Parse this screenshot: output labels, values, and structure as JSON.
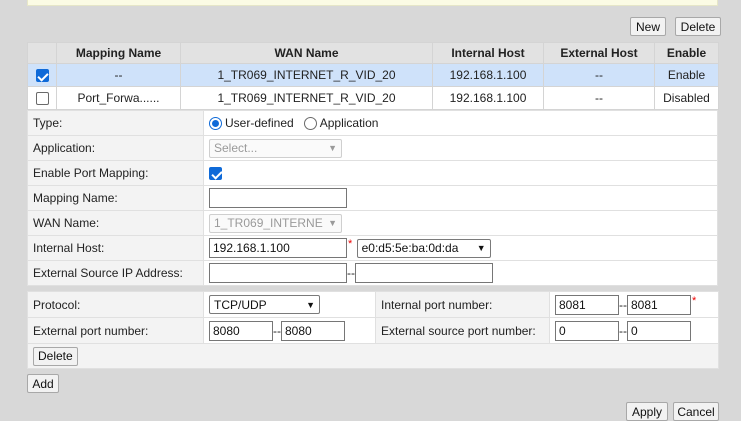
{
  "toolbar": {
    "new_label": "New",
    "delete_label": "Delete"
  },
  "mapping_table": {
    "headers": [
      "Mapping Name",
      "WAN Name",
      "Internal Host",
      "External Host",
      "Enable"
    ],
    "rows": [
      {
        "checked": true,
        "mapping_name": "--",
        "wan_name": "1_TR069_INTERNET_R_VID_20",
        "internal_host": "192.168.1.100",
        "external_host": "--",
        "enable": "Enable"
      },
      {
        "checked": false,
        "mapping_name": "Port_Forwa......",
        "wan_name": "1_TR069_INTERNET_R_VID_20",
        "internal_host": "192.168.1.100",
        "external_host": "--",
        "enable": "Disabled"
      }
    ]
  },
  "form": {
    "type_label": "Type:",
    "type_option_user": "User-defined",
    "type_option_app": "Application",
    "type_selected": "User-defined",
    "application_label": "Application:",
    "application_value": "Select...",
    "enable_label": "Enable Port Mapping:",
    "enable_checked": true,
    "mapping_name_label": "Mapping Name:",
    "mapping_name_value": "",
    "wan_name_label": "WAN Name:",
    "wan_name_value": "1_TR069_INTERNE",
    "internal_host_label": "Internal Host:",
    "internal_host_value": "192.168.1.100",
    "internal_host_mac": "e0:d5:5e:ba:0d:da",
    "ext_src_ip_label": "External Source IP Address:",
    "ext_src_ip_start": "",
    "ext_src_ip_end": ""
  },
  "ports": {
    "protocol_label": "Protocol:",
    "protocol_value": "TCP/UDP",
    "internal_port_label": "Internal port number:",
    "internal_port_start": "8081",
    "internal_port_end": "8081",
    "external_port_label": "External port number:",
    "external_port_start": "8080",
    "external_port_end": "8080",
    "ext_src_port_label": "External source port number:",
    "ext_src_port_start": "0",
    "ext_src_port_end": "0",
    "delete_label": "Delete"
  },
  "add_label": "Add",
  "apply_label": "Apply",
  "cancel_label": "Cancel",
  "required_mark": "*",
  "range_sep": "--",
  "colors": {
    "selected_row": "#cfe2fa",
    "checkbox_accent": "#0f6ad8",
    "required": "#e00000"
  }
}
